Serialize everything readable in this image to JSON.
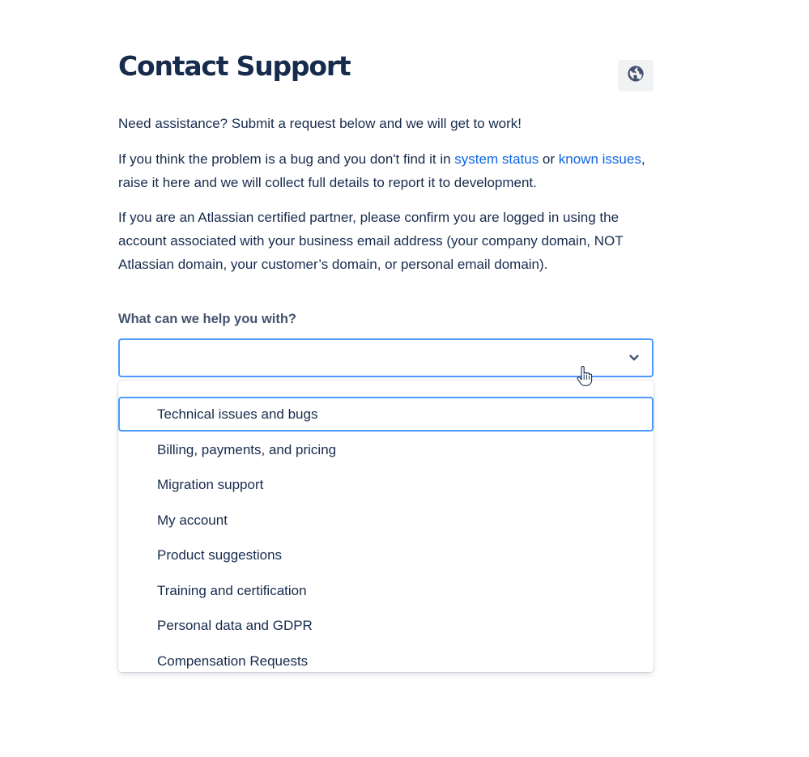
{
  "page": {
    "title": "Contact Support",
    "language_button_icon": "globe-icon"
  },
  "intro": {
    "p1": "Need assistance? Submit a request below and we will get to work!",
    "p2_before": "If you think the problem is a bug and you don't find it in ",
    "p2_link1": "system status",
    "p2_middle": " or ",
    "p2_link2": "known issues",
    "p2_after": ", raise it here and we will collect full details to report it to development.",
    "p3": "If you are an Atlassian certified partner, please confirm you are logged in using the account associated with your business email address (your company domain, NOT Atlassian domain, your customer’s domain, or personal email domain)."
  },
  "form": {
    "question_label": "What can we help you with?",
    "select_value": "",
    "select_icon": "chevron-down-icon",
    "options": [
      {
        "label": "Technical issues and bugs",
        "focused": true
      },
      {
        "label": "Billing, payments, and pricing"
      },
      {
        "label": "Migration support"
      },
      {
        "label": "My account"
      },
      {
        "label": "Product suggestions"
      },
      {
        "label": "Training and certification"
      },
      {
        "label": "Personal data and GDPR"
      },
      {
        "label": "Compensation Requests"
      }
    ]
  },
  "colors": {
    "text": "#172b4d",
    "link": "#0c66e4",
    "focus_border": "#4c9aff",
    "label": "#44546f"
  }
}
